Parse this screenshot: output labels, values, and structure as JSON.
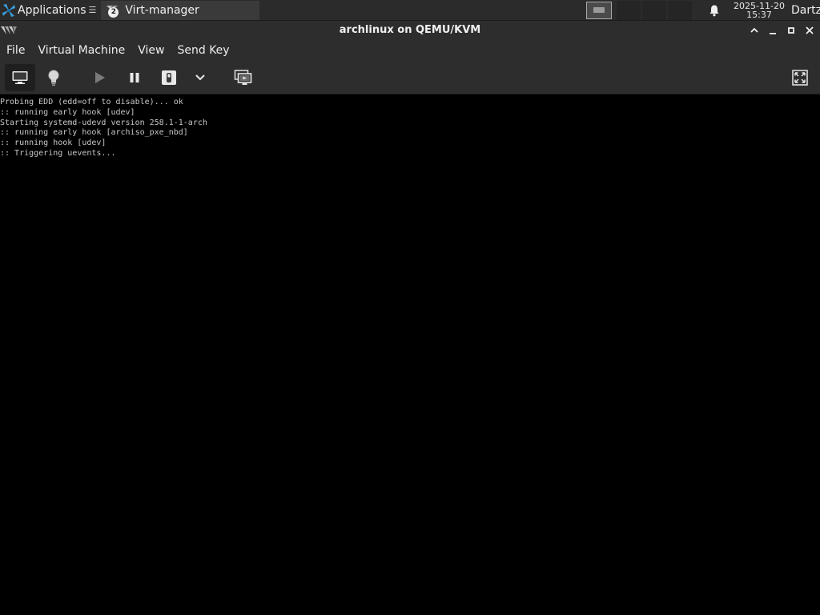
{
  "panel": {
    "applications_label": "Applications",
    "applications_menu_glyph": "☰",
    "task_label": "Virt-manager",
    "task_badge": "2",
    "clock_date": "2025-11-20",
    "clock_time": "15:37",
    "user": "Dartz",
    "icons": [
      "applications-logo-icon",
      "virt-manager-icon",
      "notification-bell-icon"
    ]
  },
  "window": {
    "title": "archlinux on QEMU/KVM",
    "controls": {
      "shade": "⌃",
      "minimize": "–",
      "maximize": "▫",
      "close": "✕"
    }
  },
  "menu": {
    "items": [
      {
        "label": "File"
      },
      {
        "label": "Virtual Machine"
      },
      {
        "label": "View"
      },
      {
        "label": "Send Key"
      }
    ]
  },
  "toolbar": {
    "buttons": [
      {
        "name": "console-view",
        "icon": "monitor-icon",
        "active": true
      },
      {
        "name": "details-view",
        "icon": "lightbulb-icon",
        "active": false
      },
      {
        "name": "run",
        "icon": "play-icon",
        "active": false
      },
      {
        "name": "pause",
        "icon": "pause-icon",
        "active": false
      },
      {
        "name": "shutdown",
        "icon": "power-switch-icon",
        "active": false
      },
      {
        "name": "shutdown-menu",
        "icon": "chevron-down-icon",
        "active": false
      },
      {
        "name": "snapshots",
        "icon": "snapshot-icon",
        "active": false
      },
      {
        "name": "fullscreen",
        "icon": "fullscreen-icon",
        "active": false
      }
    ]
  },
  "console": {
    "lines": [
      "Probing EDD (edd=off to disable)... ok",
      ":: running early hook [udev]",
      "Starting systemd-udevd version 258.1-1-arch",
      ":: running early hook [archiso_pxe_nbd]",
      ":: running hook [udev]",
      ":: Triggering uevents..."
    ]
  },
  "colors": {
    "panel_bg": "#2b2b2b",
    "window_bg": "#2d2d2d",
    "console_bg": "#000000",
    "console_text": "#c8c8c8"
  }
}
